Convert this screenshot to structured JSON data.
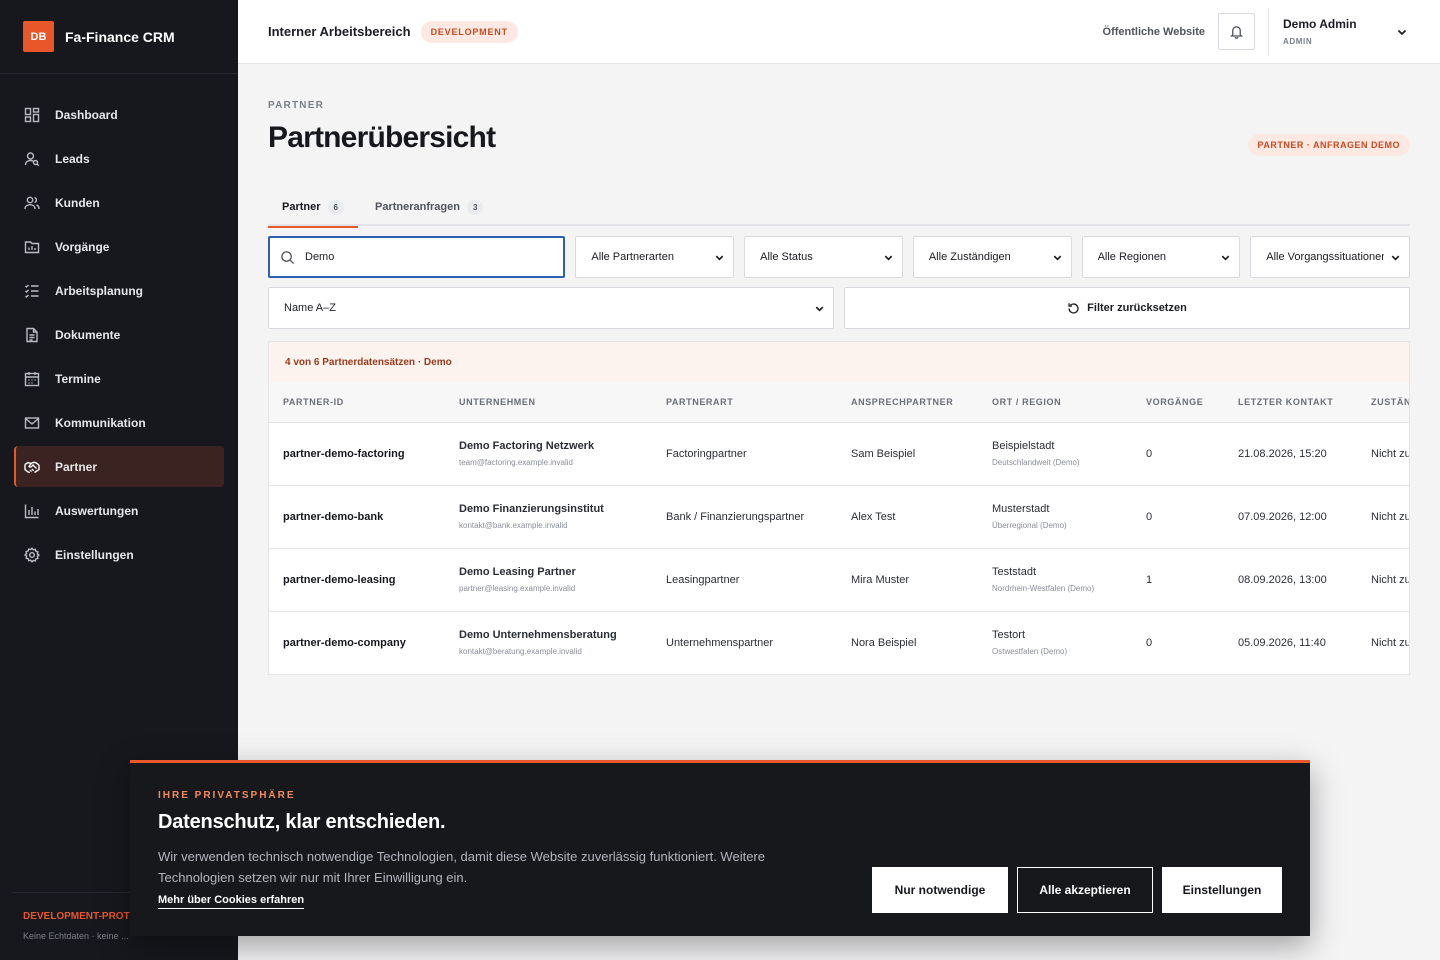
{
  "brand": {
    "logo": "DB",
    "name": "Fa-Finance CRM"
  },
  "sidebar": {
    "items": [
      {
        "label": "Dashboard",
        "icon": "dashboard-icon"
      },
      {
        "label": "Leads",
        "icon": "leads-icon"
      },
      {
        "label": "Kunden",
        "icon": "users-icon"
      },
      {
        "label": "Vorgänge",
        "icon": "folder-chart-icon"
      },
      {
        "label": "Arbeitsplanung",
        "icon": "checklist-icon"
      },
      {
        "label": "Dokumente",
        "icon": "document-icon"
      },
      {
        "label": "Termine",
        "icon": "calendar-icon"
      },
      {
        "label": "Kommunikation",
        "icon": "mail-icon"
      },
      {
        "label": "Partner",
        "icon": "handshake-icon",
        "active": true
      },
      {
        "label": "Auswertungen",
        "icon": "bar-chart-icon"
      },
      {
        "label": "Einstellungen",
        "icon": "gear-icon"
      }
    ],
    "footer_title": "DEVELOPMENT-PROT",
    "footer_text": "Keine Echtdaten · keine ..."
  },
  "topbar": {
    "workspace": "Interner Arbeitsbereich",
    "env_badge": "DEVELOPMENT",
    "public_link": "Öffentliche Website",
    "user_name": "Demo Admin",
    "user_role": "ADMIN"
  },
  "page": {
    "eyebrow": "PARTNER",
    "title": "Partnerübersicht",
    "badge": "PARTNER · ANFRAGEN DEMO",
    "tabs": [
      {
        "label": "Partner",
        "count": "6"
      },
      {
        "label": "Partneranfragen",
        "count": "3"
      }
    ]
  },
  "filters": {
    "search_value": "Demo",
    "partner_type": "Alle Partnerarten",
    "status": "Alle Status",
    "owner": "Alle Zuständigen",
    "region": "Alle Regionen",
    "situation": "Alle Vorgangssituationen",
    "sort": "Name A–Z",
    "reset": "Filter zurücksetzen"
  },
  "table": {
    "result_text": "4 von 6 Partnerdatensätzen · Demo",
    "columns": [
      "PARTNER-ID",
      "UNTERNEHMEN",
      "PARTNERART",
      "ANSPRECHPARTNER",
      "ORT / REGION",
      "VORGÄNGE",
      "LETZTER KONTAKT",
      "ZUSTÄNDIG"
    ],
    "rows": [
      {
        "id": "partner-demo-factoring",
        "company": "Demo Factoring Netzwerk",
        "email": "team@factoring.example.invalid",
        "type": "Factoringpartner",
        "contact": "Sam Beispiel",
        "city": "Beispielstadt",
        "region": "Deutschlandweit (Demo)",
        "cases": "0",
        "last_contact": "21.08.2026, 15:20",
        "owner": "Nicht zugewiesen"
      },
      {
        "id": "partner-demo-bank",
        "company": "Demo Finanzierungsinstitut",
        "email": "kontakt@bank.example.invalid",
        "type": "Bank / Finanzierungspartner",
        "contact": "Alex Test",
        "city": "Musterstadt",
        "region": "Überregional (Demo)",
        "cases": "0",
        "last_contact": "07.09.2026, 12:00",
        "owner": "Nicht zugewiesen"
      },
      {
        "id": "partner-demo-leasing",
        "company": "Demo Leasing Partner",
        "email": "partner@leasing.example.invalid",
        "type": "Leasingpartner",
        "contact": "Mira Muster",
        "city": "Teststadt",
        "region": "Nordrhein-Westfalen (Demo)",
        "cases": "1",
        "last_contact": "08.09.2026, 13:00",
        "owner": "Nicht zugewiesen"
      },
      {
        "id": "partner-demo-company",
        "company": "Demo Unternehmensberatung",
        "email": "kontakt@beratung.example.invalid",
        "type": "Unternehmenspartner",
        "contact": "Nora Beispiel",
        "city": "Testort",
        "region": "Ostwestfalen (Demo)",
        "cases": "0",
        "last_contact": "05.09.2026, 11:40",
        "owner": "Nicht zugewiesen"
      }
    ]
  },
  "cookie": {
    "eyebrow": "IHRE PRIVATSPHÄRE",
    "title": "Datenschutz, klar entschieden.",
    "text": "Wir verwenden technisch notwendige Technologien, damit diese Website zuverlässig funktioniert. Weitere Technologien setzen wir nur mit Ihrer Einwilligung ein.",
    "link": "Mehr über Cookies erfahren",
    "btn_necessary": "Nur notwendige",
    "btn_accept": "Alle akzeptieren",
    "btn_settings": "Einstellungen"
  },
  "colors": {
    "accent": "#e8572a",
    "sidebar_bg": "#16181d",
    "focus": "#2f5fae"
  }
}
